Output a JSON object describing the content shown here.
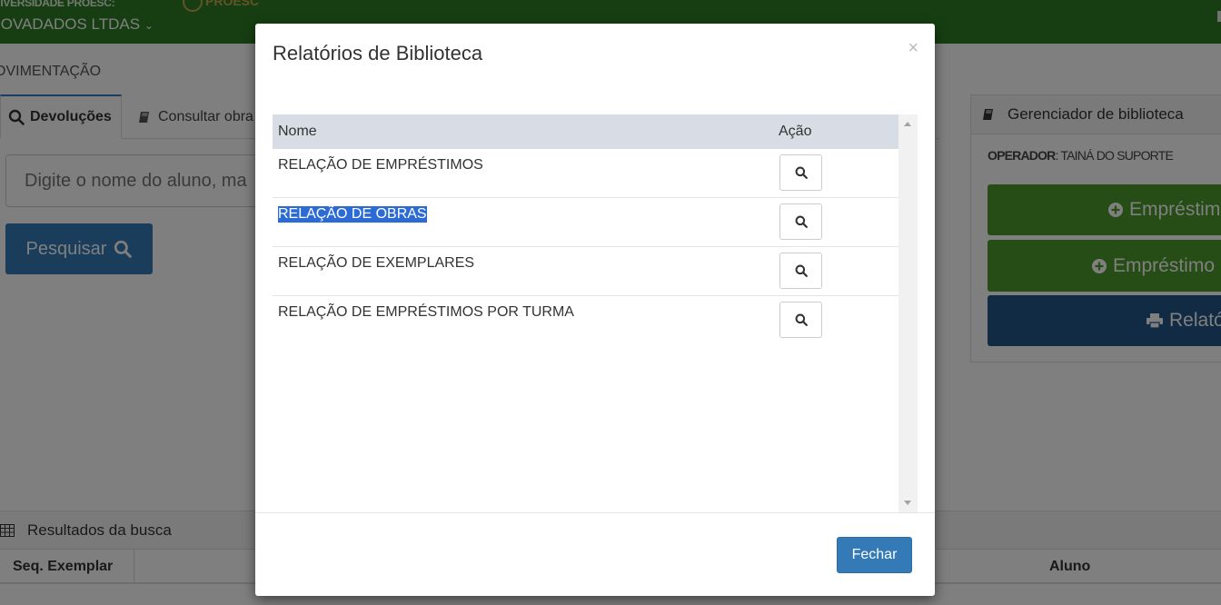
{
  "header": {
    "org_small": "NIVERSIDADE PROESC:",
    "org_name": "IOVADADOS LTDAS",
    "logo_text": "PROESC"
  },
  "page": {
    "section_title": "OVIMENTAÇÃO",
    "tabs": [
      {
        "label": "Devoluções",
        "icon": "search-icon",
        "active": true
      },
      {
        "label": "Consultar obra",
        "icon": "book-icon",
        "active": false
      }
    ],
    "search": {
      "placeholder": "Digite o nome do aluno, ma",
      "button_label": "Pesquisar"
    }
  },
  "right_panel": {
    "title": "Gerenciador de biblioteca",
    "operator_label": "OPERADOR",
    "operator_value": ": TAINÁ DO SUPORTE",
    "buttons": [
      {
        "label": "Empréstimo",
        "icon": "plus-circle-icon",
        "color": "#4c9a2a"
      },
      {
        "label": "Empréstimo",
        "icon": "plus-circle-icon",
        "color": "#4c9a2a"
      },
      {
        "label": "Relató",
        "icon": "print-icon",
        "color": "#23568a"
      }
    ]
  },
  "results": {
    "title": "Resultados da busca",
    "columns": [
      "Seq. Exemplar",
      "Aluno"
    ]
  },
  "modal": {
    "title": "Relatórios de Biblioteca",
    "close_symbol": "×",
    "columns": {
      "name": "Nome",
      "action": "Ação"
    },
    "rows": [
      {
        "name": "RELAÇÃO DE EMPRÉSTIMOS",
        "selected": false
      },
      {
        "name": "RELAÇÃO DE OBRAS",
        "selected": true
      },
      {
        "name": "RELAÇÃO DE EXEMPLARES",
        "selected": false
      },
      {
        "name": "RELAÇÃO DE EMPRÉSTIMOS POR TURMA",
        "selected": false
      }
    ],
    "close_button": "Fechar"
  },
  "colors": {
    "topbar": "#2e7d25",
    "primary": "#337ab7",
    "success": "#4c9a2a",
    "selection": "#2c6bd6",
    "table_header": "#d8dde5"
  }
}
